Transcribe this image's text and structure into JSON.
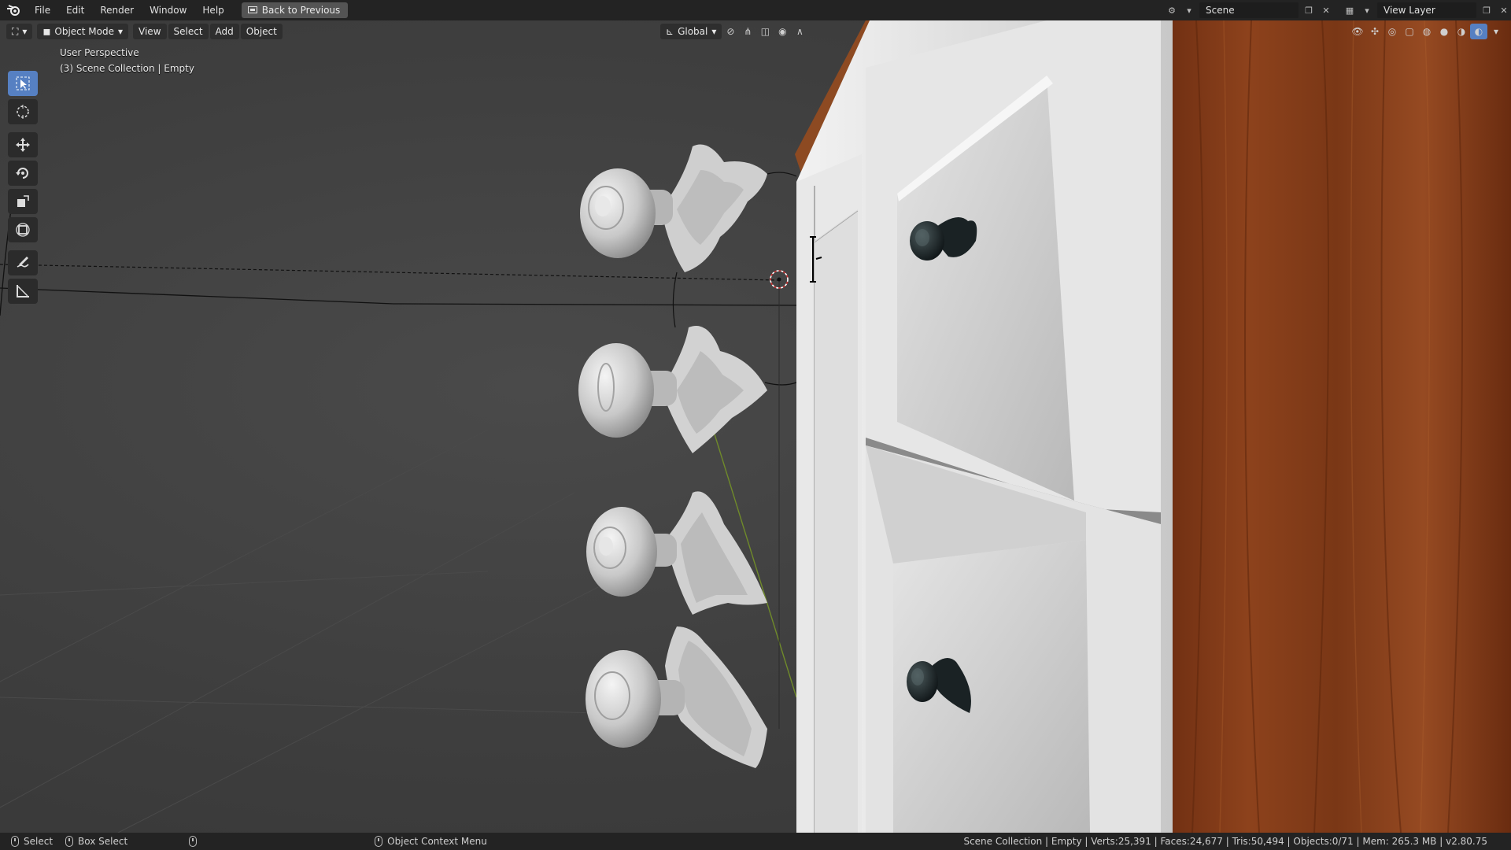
{
  "topbar": {
    "menus": [
      "File",
      "Edit",
      "Render",
      "Window",
      "Help"
    ],
    "back_button": "Back to Previous",
    "scene_name": "Scene",
    "view_layer": "View Layer"
  },
  "viewport_header": {
    "mode": "Object Mode",
    "menus": [
      "View",
      "Select",
      "Add",
      "Object"
    ],
    "transform_orientation": "Global"
  },
  "viewport": {
    "perspective": "User Perspective",
    "collection": "(3) Scene Collection | Empty"
  },
  "toolbar": {
    "tools": [
      "select-box",
      "cursor",
      "move",
      "rotate",
      "scale",
      "transform",
      "annotate",
      "measure"
    ],
    "active_tool": "select-box"
  },
  "statusbar": {
    "select": "Select",
    "box_select": "Box Select",
    "context_menu": "Object Context Menu",
    "stats": "Scene Collection | Empty | Verts:25,391 | Faces:24,677 | Tris:50,494 | Objects:0/71 | Mem: 265.3 MB | v2.80.75"
  },
  "colors": {
    "accent": "#5680c2",
    "wood": "#8a3e1a",
    "cabinet": "#d9d9d9",
    "knob_dark": "#1d2628"
  }
}
